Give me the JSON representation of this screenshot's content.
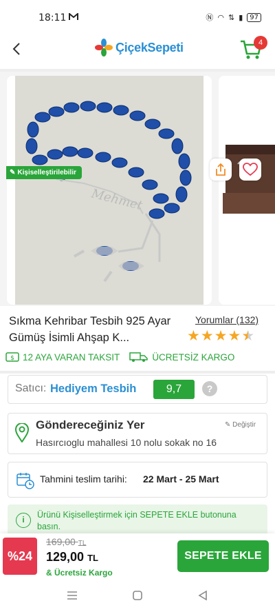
{
  "status_bar": {
    "time": "18:11",
    "battery": "97"
  },
  "header": {
    "logo_text": "ÇiçekSepeti",
    "cart_count": "4"
  },
  "product": {
    "personalizable_badge": "Kişiselleştirilebilir",
    "title": "Sıkma Kehribar Tesbih 925 Ayar Gümüş İsimli Ahşap K...",
    "engraved_name": "Mehmet",
    "reviews_label": "Yorumlar (132)",
    "rating_stars": 4.5
  },
  "perks": {
    "installment": "12 AYA VARAN TAKSIT",
    "shipping": "ÜCRETSİZ KARGO"
  },
  "seller": {
    "label": "Satıcı:",
    "name": "Hediyem Tesbih",
    "score": "9,7",
    "help": "?"
  },
  "address": {
    "heading": "Göndereceğiniz Yer",
    "edit": "Değiştir",
    "line": "Hasırcıoglu mahallesi 10 nolu sokak no 16"
  },
  "delivery": {
    "label": "Tahmini teslim tarihi:",
    "dates": "22 Mart - 25 Mart"
  },
  "info": {
    "icon": "i",
    "text": "Ürünü Kişiselleştirmek için SEPETE EKLE butonuna basın."
  },
  "purchase": {
    "discount": "%24",
    "old_price": "169,00",
    "old_currency": "TL",
    "price": "129,00",
    "currency": "TL",
    "cargo_note": "& Ücretsiz Kargo",
    "add_button": "SEPETE EKLE"
  },
  "colors": {
    "brand_blue": "#2a8fd4",
    "green": "#2aa53a",
    "red": "#e53935",
    "discount_red": "#e53950"
  }
}
